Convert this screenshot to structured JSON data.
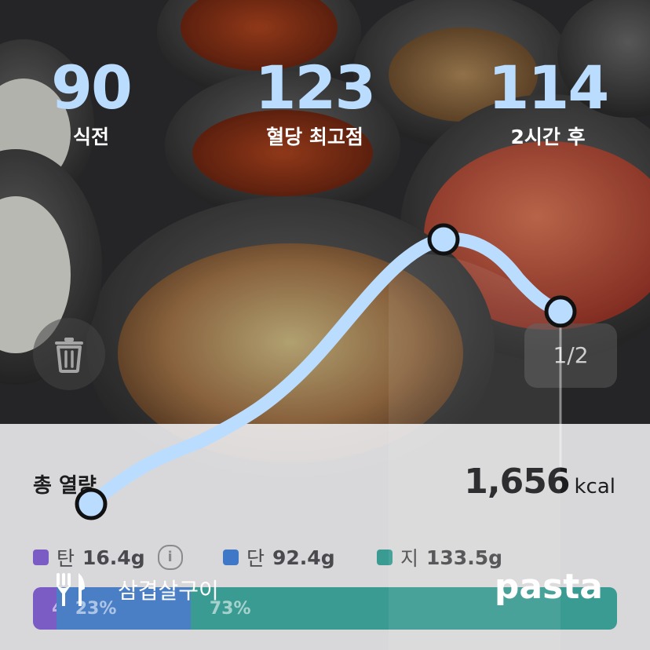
{
  "stats": [
    {
      "value": "90",
      "label": "식전"
    },
    {
      "value": "123",
      "label": "혈당 최고점"
    },
    {
      "value": "114",
      "label": "2시간 후"
    }
  ],
  "controls": {
    "page_indicator": "1/2",
    "trash_icon": "trash-icon"
  },
  "summary": {
    "calories_label": "총 열량",
    "calories_value": "1,656",
    "calories_unit": "kcal",
    "macros": [
      {
        "name": "탄",
        "value": "16.4g",
        "color": "#7b5cc4"
      },
      {
        "name": "단",
        "value": "92.4g",
        "color": "#3f78c6"
      },
      {
        "name": "지",
        "value": "133.5g",
        "color": "#3a9b92"
      }
    ],
    "info_icon": "info-icon",
    "ratio_bar": [
      {
        "label": "4%",
        "fraction": 0.04,
        "color": "#7b5cc4"
      },
      {
        "label": "23%",
        "fraction": 0.23,
        "color": "#4a7fc6"
      },
      {
        "label": "73%",
        "fraction": 0.73,
        "color": "#3a9b92"
      }
    ]
  },
  "meal": {
    "icon": "fork-knife-icon",
    "name": "삼겹살구이"
  },
  "brand": "pasta",
  "chart_data": {
    "type": "line",
    "series": [
      {
        "values": [
          90,
          123,
          114
        ]
      }
    ],
    "line_color": "#b9dcff"
  }
}
